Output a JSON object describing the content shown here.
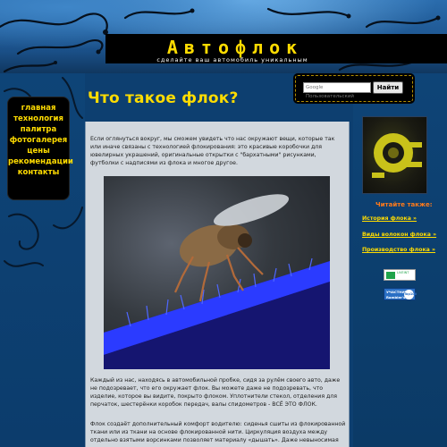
{
  "header": {
    "title": "Автофлок",
    "tagline": "сделайте ваш автомобиль уникальным"
  },
  "nav": {
    "items": [
      {
        "label": "главная"
      },
      {
        "label": "технология"
      },
      {
        "label": "палитра"
      },
      {
        "label": "фотогалерея"
      },
      {
        "label": "цены"
      },
      {
        "label": "рекомендации"
      },
      {
        "label": "контакты"
      }
    ]
  },
  "search": {
    "placeholder": "Google Пользовательский",
    "button_label": "Найти"
  },
  "main": {
    "heading": "Что такое флок?",
    "paragraphs": [
      "Если оглянуться вокруг, мы сможем увидеть что нас окружают вещи, которые так или иначе связаны с технологией флокирования: это красивые коробочки для ювелирных украшений, оригинальные открытки с \"бархатными\" рисунками, футболки с надписями из флока и многое другое.",
      "Каждый из нас, находясь в автомобильной пробке, сидя за рулём своего авто, даже не подозревает, что его окружает флок. Вы можете даже не подозревать, что изделие, которое вы видите, покрыто флоком. Уплотнители стекол, отделения для перчаток, шестерёнки коробок передач, валы спидометров - ВСЁ ЭТО ФЛОК.",
      "Флок создаёт дополнительный комфорт водителю: сиденья сшиты из флокированной ткани или из ткани на основе флокированной нити. Циркуляция воздуха между отдельно взятыми ворсинками позволяет материалу «дышать». Даже невыносимая"
    ]
  },
  "sidebar": {
    "read_also": "Читайте также:",
    "links": [
      {
        "label": "История флока »"
      },
      {
        "label": "Виды волокон флока »"
      },
      {
        "label": "Производство флока »"
      }
    ],
    "badges": [
      {
        "text": "LIVEINT"
      },
      {
        "line1": "УЧАСТНИК",
        "line2": "Rambler's",
        "count": "Top100"
      }
    ]
  },
  "colors": {
    "accent_yellow": "#ffdc00",
    "header_blue": "#2a6cad",
    "content_bg": "#d2d8de",
    "read_also_orange": "#ff7a1a"
  },
  "icons": {
    "photo": "fly-on-blue-flock-photo",
    "thumb": "flocked-car-part-thumbnail"
  }
}
